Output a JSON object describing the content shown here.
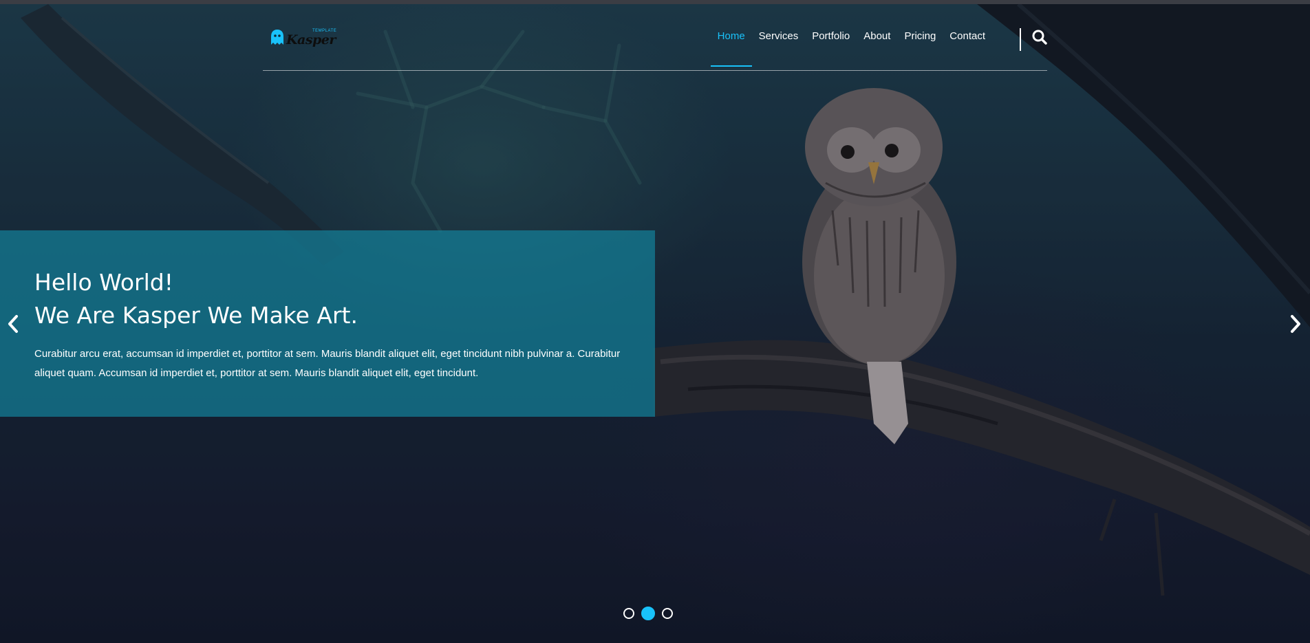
{
  "brand": {
    "logo_word": "Kasper",
    "logo_tag": "TEMPLATE",
    "accent_color": "#19c2fa"
  },
  "nav": {
    "items": [
      {
        "label": "Home",
        "active": true
      },
      {
        "label": "Services",
        "active": false
      },
      {
        "label": "Portfolio",
        "active": false
      },
      {
        "label": "About",
        "active": false
      },
      {
        "label": "Pricing",
        "active": false
      },
      {
        "label": "Contact",
        "active": false
      }
    ],
    "search_icon": "search-icon"
  },
  "slide": {
    "title_line1": "Hello World!",
    "title_line2": "We Are Kasper We Make Art.",
    "body": "Curabitur arcu erat, accumsan id imperdiet et, porttitor at sem. Mauris blandit aliquet elit, eget tincidunt nibh pulvinar a. Curabitur aliquet quam. Accumsan id imperdiet et, porttitor at sem. Mauris blandit aliquet elit, eget tincidunt.",
    "box_color": "#138098"
  },
  "slider": {
    "prev_icon": "chevron-left-icon",
    "next_icon": "chevron-right-icon",
    "slide_count": 3,
    "active_slide": 2
  }
}
